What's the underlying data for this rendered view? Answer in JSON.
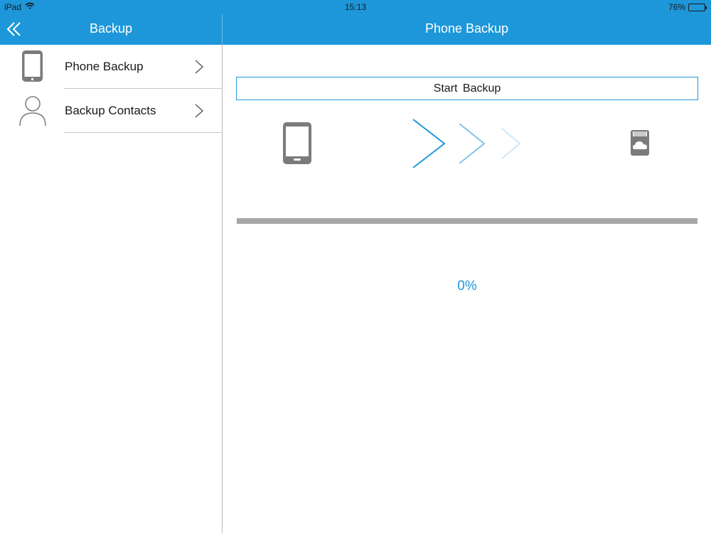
{
  "status_bar": {
    "device": "iPad",
    "time": "15:13",
    "battery_text": "76%",
    "battery_level": 0.76,
    "wifi_icon": "wifi-icon"
  },
  "master": {
    "title": "Backup",
    "back_icon": "double-chevron-left-icon",
    "items": [
      {
        "label": "Phone Backup",
        "icon": "phone-icon"
      },
      {
        "label": "Backup Contacts",
        "icon": "person-icon"
      }
    ]
  },
  "detail": {
    "title": "Phone Backup",
    "start_button": "Start  Backup",
    "progress": 0,
    "progress_text": "0%"
  },
  "colors": {
    "accent": "#1d97d9",
    "track": "#a6a6a6",
    "icon_gray": "#7b7b7b"
  }
}
